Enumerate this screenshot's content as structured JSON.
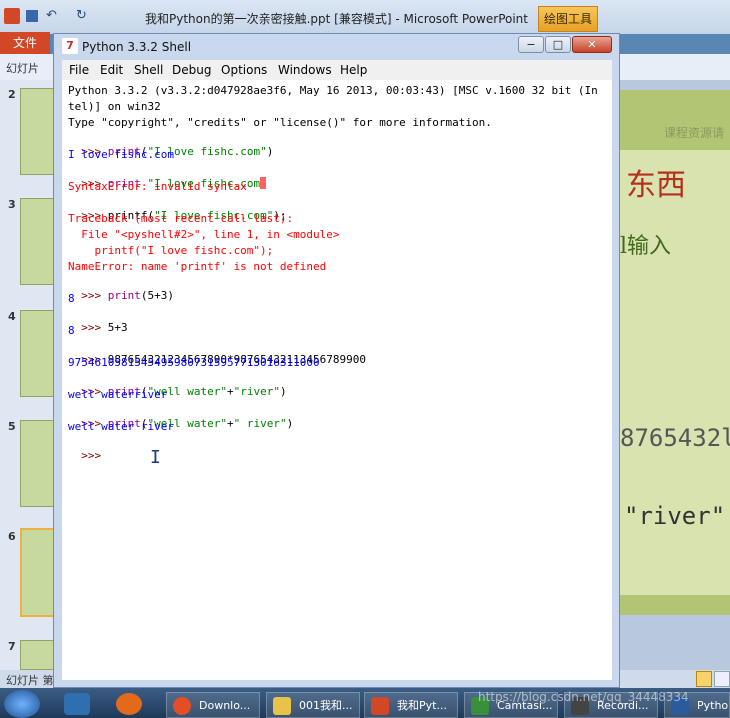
{
  "ppt": {
    "title": "我和Python的第一次亲密接触.ppt [兼容模式] - Microsoft PowerPoint",
    "drawing_tools": "绘图工具",
    "file_tab": "文件",
    "slides_label": "幻灯片",
    "slide_numbers": [
      "2",
      "3",
      "4",
      "5",
      "6",
      "7"
    ],
    "status": "幻灯片 第",
    "slide_text": {
      "top_right": "课程资源请",
      "dongxi": "东西",
      "shuru": "l输入",
      "number": "8765432l",
      "river": "\"river\""
    }
  },
  "shell": {
    "title": "Python 3.3.2 Shell",
    "menus": [
      "File",
      "Edit",
      "Shell",
      "Debug",
      "Options",
      "Windows",
      "Help"
    ],
    "lines": [
      {
        "kind": "cmd",
        "text": "Python 3.3.2 (v3.3.2:d047928ae3f6, May 16 2013, 00:03:43) [MSC v.1600 32 bit (In"
      },
      {
        "kind": "cmd",
        "text": "tel)] on win32"
      },
      {
        "kind": "cmd",
        "text": "Type \"copyright\", \"credits\" or \"license()\" for more information."
      },
      {
        "kind": "prompt",
        "prompt": ">>> ",
        "code": "print(\"I love fishc.com\")"
      },
      {
        "kind": "out",
        "text": "I love fishc.com"
      },
      {
        "kind": "prompt",
        "prompt": ">>> ",
        "code": "print \"I love fishc.com\""
      },
      {
        "kind": "err",
        "text": "SyntaxError: invalid syntax"
      },
      {
        "kind": "prompt",
        "prompt": ">>> ",
        "code": "printf(\"I love fishc.com\");"
      },
      {
        "kind": "err",
        "text": "Traceback (most recent call last):"
      },
      {
        "kind": "err",
        "text": "  File \"<pyshell#2>\", line 1, in <module>"
      },
      {
        "kind": "err",
        "text": "    printf(\"I love fishc.com\");"
      },
      {
        "kind": "err",
        "text": "NameError: name 'printf' is not defined"
      },
      {
        "kind": "prompt",
        "prompt": ">>> ",
        "code": "print(5+3)"
      },
      {
        "kind": "out",
        "text": "8"
      },
      {
        "kind": "prompt",
        "prompt": ">>> ",
        "code": "5+3"
      },
      {
        "kind": "out",
        "text": "8"
      },
      {
        "kind": "prompt",
        "prompt": ">>> ",
        "code": "987654321234567890*98765432113456789900"
      },
      {
        "kind": "out",
        "text": "97546105815454959807315957713016311000"
      },
      {
        "kind": "prompt",
        "prompt": ">>> ",
        "code": "print(\"well water\"+\"river\")"
      },
      {
        "kind": "out",
        "text": "well waterriver"
      },
      {
        "kind": "prompt",
        "prompt": ">>> ",
        "code": "print(\"well water\"+\" river\")"
      },
      {
        "kind": "out",
        "text": "well water river"
      },
      {
        "kind": "prompt",
        "prompt": ">>> ",
        "code": ""
      }
    ]
  },
  "taskbar": {
    "items": [
      {
        "label": "Downlo...",
        "color": "#e44d26"
      },
      {
        "label": "001我和...",
        "color": "#e8c34a"
      },
      {
        "label": "我和Pyt...",
        "color": "#d24726"
      },
      {
        "label": "Camtasi...",
        "color": "#3a8f3a"
      },
      {
        "label": "Recordi...",
        "color": "#444444"
      },
      {
        "label": "Pytho",
        "color": "#2b5b9b"
      }
    ],
    "watermark": "https://blog.csdn.net/qq_34448334"
  },
  "colors": {
    "prompt": "#7f0000",
    "output": "#0000ff",
    "error": "#ff0000",
    "string": "#008000",
    "builtin": "#900090"
  }
}
